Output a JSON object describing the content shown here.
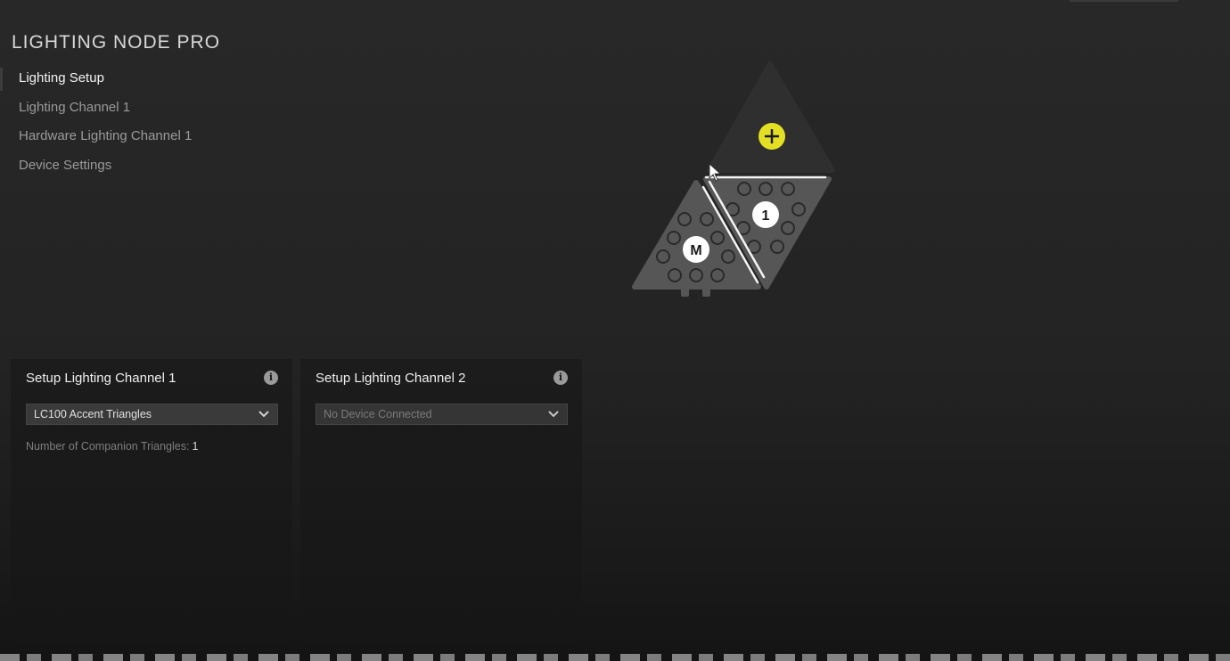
{
  "device": {
    "title": "LIGHTING NODE PRO"
  },
  "nav": {
    "items": [
      {
        "label": "Lighting Setup"
      },
      {
        "label": "Lighting Channel 1"
      },
      {
        "label": "Hardware Lighting Channel 1"
      },
      {
        "label": "Device Settings"
      }
    ]
  },
  "preview": {
    "master_label": "M",
    "companion_label": "1",
    "accent_color": "#e3e024"
  },
  "channels": [
    {
      "title": "Setup Lighting Channel 1",
      "selected_device": "LC100 Accent Triangles",
      "companion_label": "Number of Companion Triangles:",
      "companion_count": "1"
    },
    {
      "title": "Setup Lighting Channel 2",
      "selected_device": "No Device Connected"
    }
  ]
}
